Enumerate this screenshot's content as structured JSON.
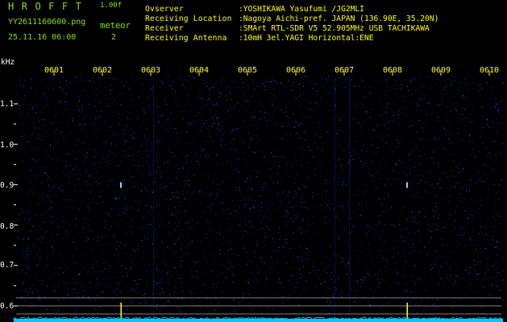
{
  "header": {
    "app_name": "HROFFT",
    "app_version": "1.00f",
    "file_name": "YY2611160600.png",
    "mode_label": "meteor",
    "date_time": "25.11.16 06:00",
    "count": "2"
  },
  "info": [
    {
      "key": "Ovserver",
      "value": ":YOSHIKAWA Yasufumi /JG2MLI"
    },
    {
      "key": "Receiving Location",
      "value": ":Nagoya Aichi-pref. JAPAN (136.90E, 35.20N)"
    },
    {
      "key": "Receiver",
      "value": ":SMArt RTL-SDR V5 52.905MHz USB TACHIKAWA"
    },
    {
      "key": "Receiving Antenna",
      "value": ":10mH 3el.YAGI Horizontal:ENE"
    }
  ],
  "plot": {
    "y_unit": "kHz",
    "y_ticks": [
      "1.1",
      "1.0",
      "0.9",
      "0.8",
      "0.7",
      "0.6"
    ],
    "x_ticks": [
      "0601",
      "0602",
      "0603",
      "0604",
      "0605",
      "0606",
      "0607",
      "0608",
      "0609",
      "0610"
    ],
    "colors": {
      "background": "#000000",
      "noise": "#1010a0",
      "baseline": "#00c8ff",
      "tick": "#ffff00",
      "label": "#ffffff",
      "accent": "#86e000"
    },
    "meteor_echoes": [
      {
        "time": "0602",
        "frequency_khz": 0.9
      },
      {
        "time": "0608",
        "frequency_khz": 0.9
      }
    ]
  }
}
